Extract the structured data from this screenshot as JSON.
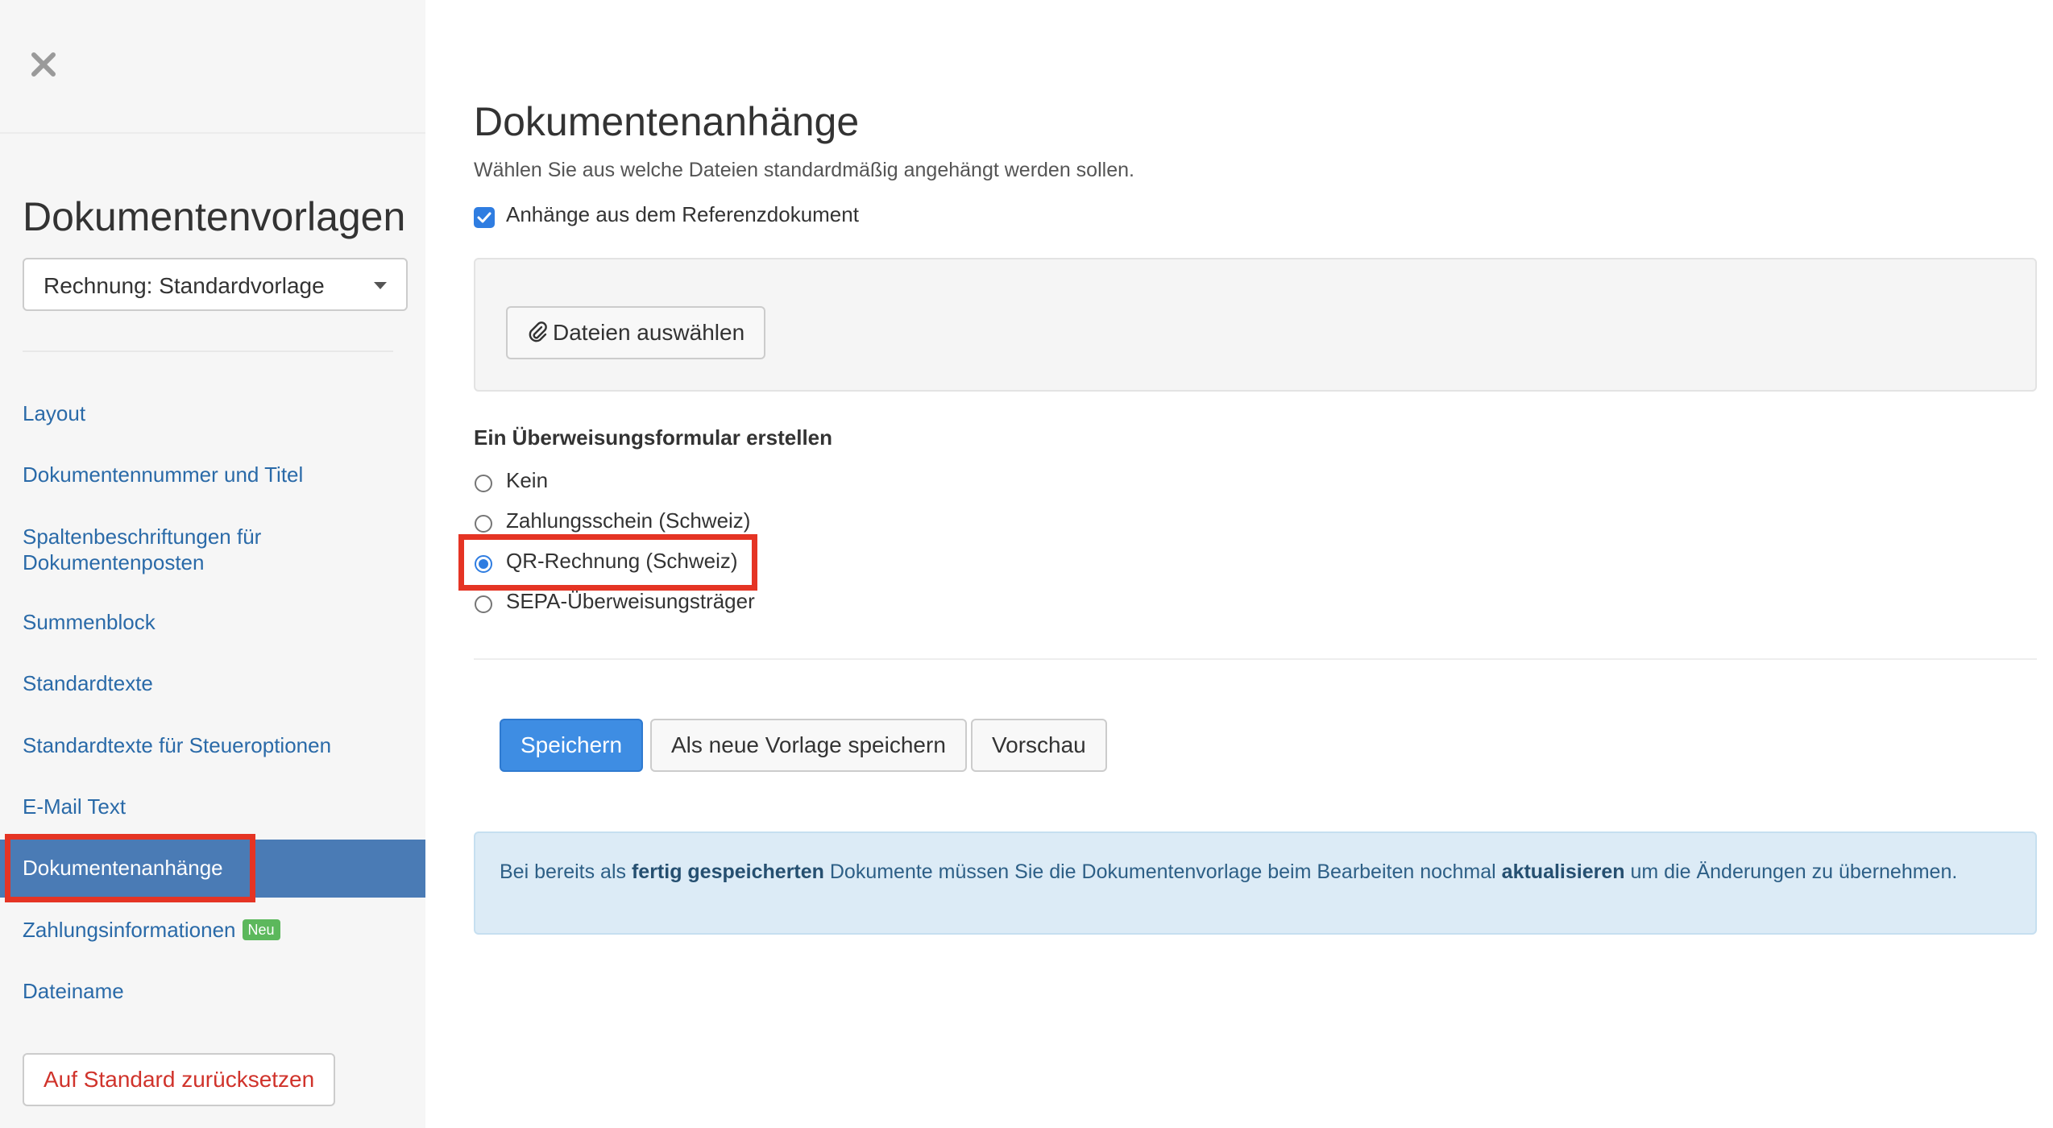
{
  "sidebar": {
    "title": "Dokumentenvorlagen",
    "template_select": {
      "value": "Rechnung: Standardvorlage"
    },
    "items": [
      {
        "label": "Layout"
      },
      {
        "label": "Dokumentennummer und Titel"
      },
      {
        "label": "Spaltenbeschriftungen für",
        "label2": "Dokumentenposten"
      },
      {
        "label": "Summenblock"
      },
      {
        "label": "Standardtexte"
      },
      {
        "label": "Standardtexte für Steueroptionen"
      },
      {
        "label": "E-Mail Text"
      },
      {
        "label": "Dokumentenanhänge",
        "active": true
      },
      {
        "label": "Zahlungsinformationen",
        "badge": "Neu"
      },
      {
        "label": "Dateiname"
      }
    ],
    "reset_button": "Auf Standard zurücksetzen"
  },
  "main": {
    "title": "Dokumentenanhänge",
    "subtitle": "Wählen Sie aus welche Dateien standardmäßig angehängt werden sollen.",
    "reference_checkbox": {
      "label": "Anhänge aus dem Referenzdokument",
      "checked": true
    },
    "file_button": "Dateien auswählen",
    "transfer_form": {
      "label": "Ein Überweisungsformular erstellen",
      "options": [
        {
          "label": "Kein",
          "checked": false
        },
        {
          "label": "Zahlungsschein (Schweiz)",
          "checked": false
        },
        {
          "label": "QR-Rechnung (Schweiz)",
          "checked": true
        },
        {
          "label": "SEPA-Überweisungsträger",
          "checked": false
        }
      ]
    },
    "buttons": {
      "save": "Speichern",
      "save_as_new": "Als neue Vorlage speichern",
      "preview": "Vorschau"
    },
    "info": {
      "part1": "Bei bereits als ",
      "bold1": "fertig gespeicherten",
      "part2": " Dokumente müssen Sie die Dokumentenvorlage beim Bearbeiten nochmal ",
      "bold2": "aktualisieren",
      "part3": " um die Änderungen zu übernehmen."
    }
  },
  "colors": {
    "link": "#2a6aa8",
    "active_nav": "#4a7bb5",
    "primary": "#3e8de3",
    "highlight": "#e53424",
    "badge": "#5cb85c",
    "danger": "#d0332b"
  }
}
